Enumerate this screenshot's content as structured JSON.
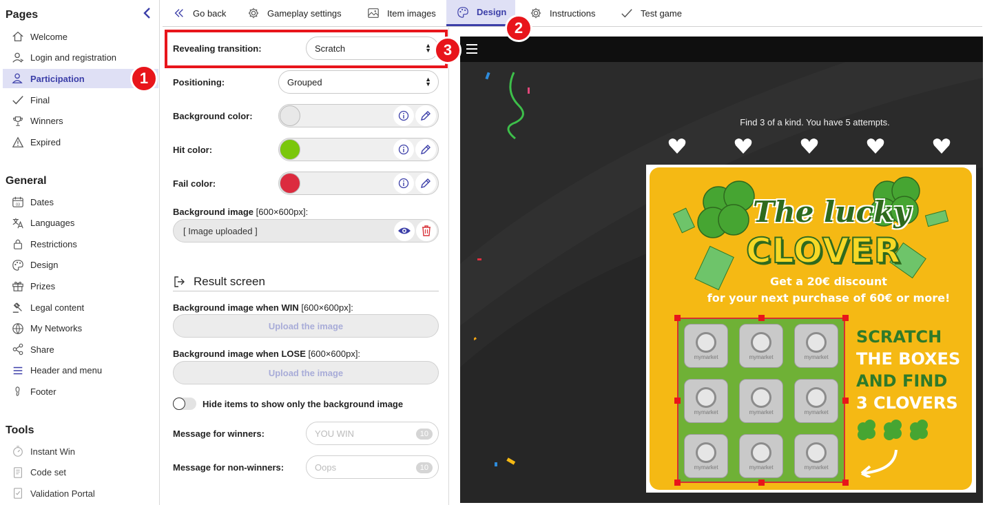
{
  "sidebar": {
    "pages_title": "Pages",
    "pages": [
      {
        "label": "Welcome",
        "icon": "home-icon"
      },
      {
        "label": "Login and registration",
        "icon": "user-login-icon"
      },
      {
        "label": "Participation",
        "icon": "user-participation-icon",
        "active": true
      },
      {
        "label": "Final",
        "icon": "check-icon"
      },
      {
        "label": "Winners",
        "icon": "trophy-icon"
      },
      {
        "label": "Expired",
        "icon": "warning-icon"
      }
    ],
    "general_title": "General",
    "general": [
      {
        "label": "Dates",
        "icon": "calendar-icon"
      },
      {
        "label": "Languages",
        "icon": "translate-icon"
      },
      {
        "label": "Restrictions",
        "icon": "lock-icon"
      },
      {
        "label": "Design",
        "icon": "palette-icon"
      },
      {
        "label": "Prizes",
        "icon": "gift-icon"
      },
      {
        "label": "Legal content",
        "icon": "gavel-icon"
      },
      {
        "label": "My Networks",
        "icon": "globe-icon"
      },
      {
        "label": "Share",
        "icon": "share-icon"
      },
      {
        "label": "Header and menu",
        "icon": "menu-icon"
      },
      {
        "label": "Footer",
        "icon": "footer-icon"
      }
    ],
    "tools_title": "Tools",
    "tools": [
      {
        "label": "Instant Win",
        "icon": "stopwatch-icon"
      },
      {
        "label": "Code set",
        "icon": "code-set-icon"
      },
      {
        "label": "Validation Portal",
        "icon": "validation-icon"
      }
    ]
  },
  "tabs": [
    {
      "label": "Go back",
      "icon": "double-chevron-left-icon"
    },
    {
      "label": "Gameplay settings",
      "icon": "gear-icon"
    },
    {
      "label": "Item images",
      "icon": "image-icon"
    },
    {
      "label": "Design",
      "icon": "palette-icon",
      "active": true
    },
    {
      "label": "Instructions",
      "icon": "gear-icon"
    },
    {
      "label": "Test game",
      "icon": "check-icon"
    }
  ],
  "settings": {
    "revealing_label": "Revealing transition:",
    "revealing_value": "Scratch",
    "positioning_label": "Positioning:",
    "positioning_value": "Grouped",
    "bg_color_label": "Background color:",
    "bg_color": "#e8e8e8",
    "hit_color_label": "Hit color:",
    "hit_color": "#7ac70c",
    "fail_color_label": "Fail color:",
    "fail_color": "#dc2b3f",
    "bg_image_label": "Background image",
    "bg_image_size": "[600×600px]:",
    "bg_image_value": "[ Image uploaded ]",
    "result_screen_title": "Result screen",
    "win_image_label": "Background image when WIN",
    "win_image_size": "[600×600px]:",
    "upload_label": "Upload the image",
    "lose_image_label": "Background image when LOSE",
    "lose_image_size": "[600×600px]:",
    "hide_items_label": "Hide items to show only the background image",
    "hide_items_on": false,
    "winners_msg_label": "Message for winners:",
    "winners_msg_placeholder": "YOU WIN",
    "winners_msg_count": "10",
    "nonwinners_msg_label": "Message for non-winners:",
    "nonwinners_msg_placeholder": "Oops",
    "nonwinners_msg_count": "10"
  },
  "annotations": {
    "badge1": "1",
    "badge2": "2",
    "badge3": "3",
    "accent": "#e8151b"
  },
  "preview": {
    "hint": "Find 3 of a kind. You have 5 attempts.",
    "attempts": 5,
    "title_line1": "The lucky",
    "title_line2": "CLOVER",
    "promo_line1": "Get a 20€ discount",
    "promo_line2": "for your next purchase of 60€ or more!",
    "scratch_lines": [
      "SCRATCH",
      "THE BOXES",
      "AND FIND",
      "3 CLOVERS"
    ],
    "cell_brand": "mymarket"
  },
  "colors": {
    "accent": "#3b3ea8",
    "active_bg": "#dfe0f5",
    "card_bg": "#f5b914"
  }
}
